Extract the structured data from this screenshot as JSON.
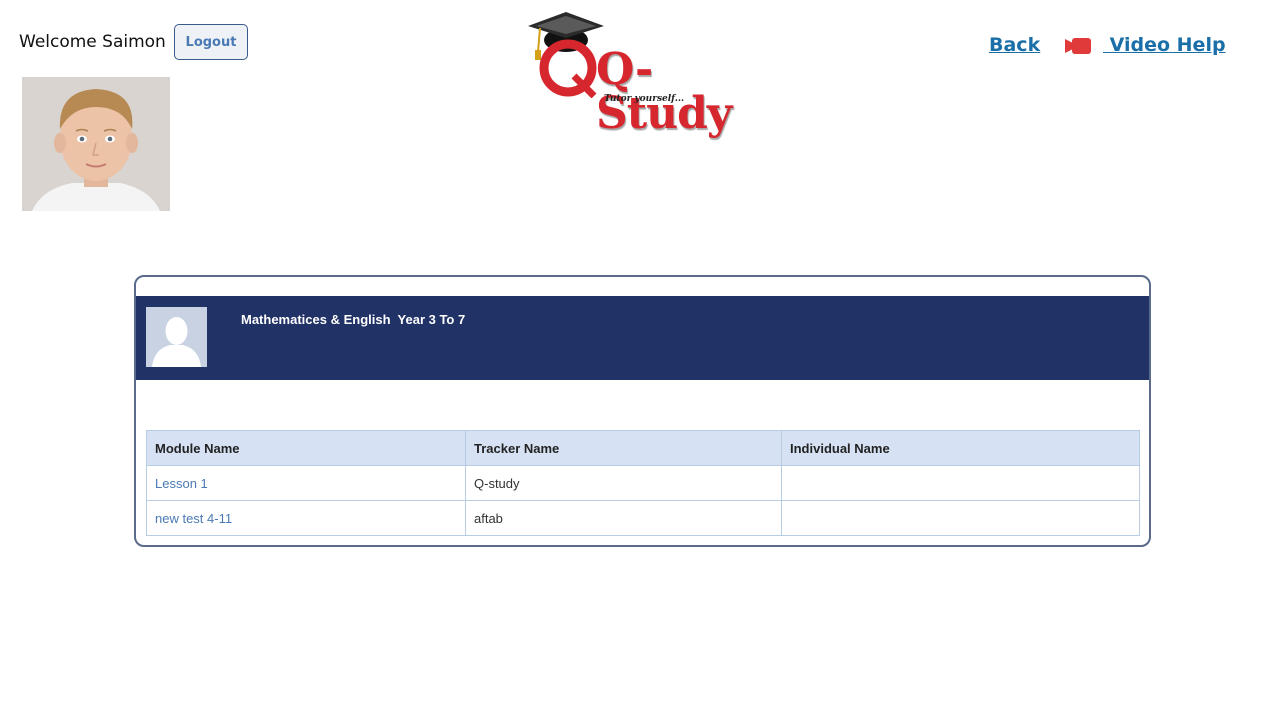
{
  "header": {
    "welcome_text": "Welcome Saimon",
    "logout_label": "Logout",
    "back_label": "Back",
    "video_help_label": " Video Help"
  },
  "logo": {
    "brand_text": "Q-Study",
    "tagline": "Tutor yourself..."
  },
  "course": {
    "title": "Mathematices & English  Year 3 To 7"
  },
  "table": {
    "columns": [
      "Module Name",
      "Tracker Name",
      "Individual Name"
    ],
    "rows": [
      {
        "module": "Lesson 1",
        "tracker": "Q-study",
        "individual": ""
      },
      {
        "module": "new test 4-11",
        "tracker": "aftab",
        "individual": ""
      }
    ]
  },
  "colors": {
    "header_band": "#203266",
    "link": "#1a6fa8",
    "brand_red": "#d6262e",
    "table_header_bg": "#d6e2f3"
  },
  "icons": {
    "video": "video-camera-icon",
    "profile": "user-avatar",
    "course": "user-silhouette-icon"
  }
}
